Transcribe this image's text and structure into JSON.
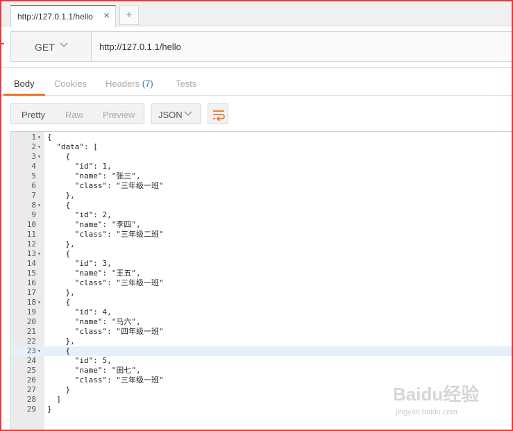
{
  "tabs": [
    {
      "label": "http://127.0.1.1/hello",
      "close": "×"
    }
  ],
  "new_tab": "+",
  "request": {
    "method": "GET",
    "url": "http://127.0.1.1/hello"
  },
  "response_tabs": {
    "body": "Body",
    "cookies": "Cookies",
    "headers": "Headers",
    "headers_count": "(7)",
    "tests": "Tests"
  },
  "view_modes": {
    "pretty": "Pretty",
    "raw": "Raw",
    "preview": "Preview"
  },
  "format": "JSON",
  "code_lines": [
    {
      "n": "1",
      "fold": true,
      "text": "{"
    },
    {
      "n": "2",
      "fold": true,
      "text": "  \"data\": ["
    },
    {
      "n": "3",
      "fold": true,
      "text": "    {"
    },
    {
      "n": "4",
      "fold": false,
      "text": "      \"id\": 1,"
    },
    {
      "n": "5",
      "fold": false,
      "text": "      \"name\": \"张三\","
    },
    {
      "n": "6",
      "fold": false,
      "text": "      \"class\": \"三年级一班\""
    },
    {
      "n": "7",
      "fold": false,
      "text": "    },"
    },
    {
      "n": "8",
      "fold": true,
      "text": "    {"
    },
    {
      "n": "9",
      "fold": false,
      "text": "      \"id\": 2,"
    },
    {
      "n": "10",
      "fold": false,
      "text": "      \"name\": \"李四\","
    },
    {
      "n": "11",
      "fold": false,
      "text": "      \"class\": \"三年级二班\""
    },
    {
      "n": "12",
      "fold": false,
      "text": "    },"
    },
    {
      "n": "13",
      "fold": true,
      "text": "    {"
    },
    {
      "n": "14",
      "fold": false,
      "text": "      \"id\": 3,"
    },
    {
      "n": "15",
      "fold": false,
      "text": "      \"name\": \"王五\","
    },
    {
      "n": "16",
      "fold": false,
      "text": "      \"class\": \"三年级一班\""
    },
    {
      "n": "17",
      "fold": false,
      "text": "    },"
    },
    {
      "n": "18",
      "fold": true,
      "text": "    {"
    },
    {
      "n": "19",
      "fold": false,
      "text": "      \"id\": 4,"
    },
    {
      "n": "20",
      "fold": false,
      "text": "      \"name\": \"马六\","
    },
    {
      "n": "21",
      "fold": false,
      "text": "      \"class\": \"四年级一班\""
    },
    {
      "n": "22",
      "fold": false,
      "text": "    },"
    },
    {
      "n": "23",
      "fold": true,
      "text": "    {",
      "active": true
    },
    {
      "n": "24",
      "fold": false,
      "text": "      \"id\": 5,"
    },
    {
      "n": "25",
      "fold": false,
      "text": "      \"name\": \"田七\","
    },
    {
      "n": "26",
      "fold": false,
      "text": "      \"class\": \"三年级一班\""
    },
    {
      "n": "27",
      "fold": false,
      "text": "    }"
    },
    {
      "n": "28",
      "fold": false,
      "text": "  ]"
    },
    {
      "n": "29",
      "fold": false,
      "text": "}"
    }
  ],
  "watermark": {
    "brand": "Baidu经验",
    "url": "jingyan.baidu.com"
  }
}
